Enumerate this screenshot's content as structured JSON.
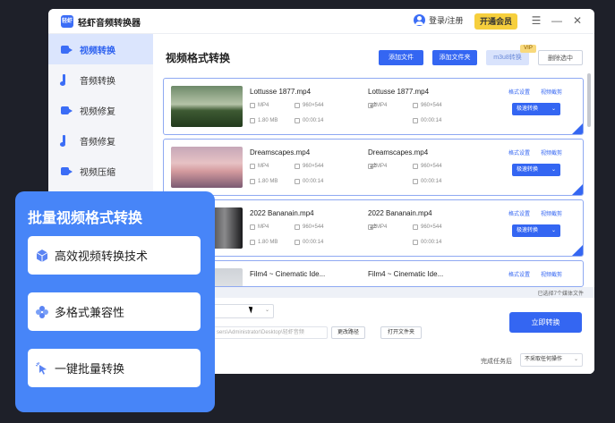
{
  "app": {
    "title": "轻虾音频转换器",
    "logo_text": "轻虾"
  },
  "titlebar": {
    "login": "登录/注册",
    "vip": "开通会员"
  },
  "sidebar": {
    "items": [
      {
        "label": "视频转换",
        "icon": "video-convert-icon",
        "active": true
      },
      {
        "label": "音频转换",
        "icon": "audio-convert-icon",
        "active": false
      },
      {
        "label": "视频修复",
        "icon": "video-repair-icon",
        "active": false
      },
      {
        "label": "音频修复",
        "icon": "audio-repair-icon",
        "active": false
      },
      {
        "label": "视频压缩",
        "icon": "video-compress-icon",
        "active": false
      }
    ]
  },
  "main": {
    "title": "视频格式转换",
    "toolbar": {
      "add_file": "添加文件",
      "add_folder": "添加文件夹",
      "m3u8": "m3u8转换",
      "vip_tag": "VIP",
      "clear": "删除选中"
    },
    "files": [
      {
        "src_name": "Lottusse 1877.mp4",
        "dst_name": "Lottusse 1877.mp4",
        "format": "MP4",
        "resolution": "960×544",
        "size": "1.80 MB",
        "duration": "00:00:14",
        "dst_format": "MP4",
        "dst_resolution": "960×544",
        "dst_duration": "00:00:14",
        "settings": "格式设置",
        "edit": "视频截剪",
        "convert": "极速转换"
      },
      {
        "src_name": "Dreamscapes.mp4",
        "dst_name": "Dreamscapes.mp4",
        "format": "MP4",
        "resolution": "960×544",
        "size": "1.80 MB",
        "duration": "00:00:14",
        "dst_format": "MP4",
        "dst_resolution": "960×544",
        "dst_duration": "00:00:14",
        "settings": "格式设置",
        "edit": "视频截剪",
        "convert": "极速转换"
      },
      {
        "src_name": "2022 Bananain.mp4",
        "dst_name": "2022 Bananain.mp4",
        "format": "MP4",
        "resolution": "960×544",
        "size": "1.80 MB",
        "duration": "00:00:14",
        "dst_format": "MP4",
        "dst_resolution": "960×544",
        "dst_duration": "00:00:14",
        "settings": "格式设置",
        "edit": "视频截剪",
        "convert": "极速转换"
      },
      {
        "src_name": "Film4 ~ Cinematic Ide...",
        "dst_name": "Film4 ~ Cinematic Ide...",
        "format": "",
        "resolution": "",
        "size": "",
        "duration": "",
        "dst_format": "",
        "dst_resolution": "",
        "dst_duration": "",
        "settings": "格式设置",
        "edit": "视频截剪",
        "convert": ""
      }
    ],
    "selected_count": "已选择7个媒体文件"
  },
  "bottom": {
    "path_value": "sers\\Administrator\\Desktop\\轻虾音频",
    "change_path": "更改路径",
    "open_folder": "打开文件夹",
    "start": "立即转换",
    "done_label": "完成任务后",
    "done_option": "不采取任何操作"
  },
  "promo": {
    "title": "批量视频格式转换",
    "features": [
      {
        "label": "高效视频转换技术",
        "icon": "cube-icon"
      },
      {
        "label": "多格式兼容性",
        "icon": "flower-icon"
      },
      {
        "label": "一键批量转换",
        "icon": "cursor-click-icon"
      }
    ]
  },
  "colors": {
    "primary": "#3466f2",
    "promo_bg": "#4785f8",
    "vip": "#f6cf3d"
  }
}
